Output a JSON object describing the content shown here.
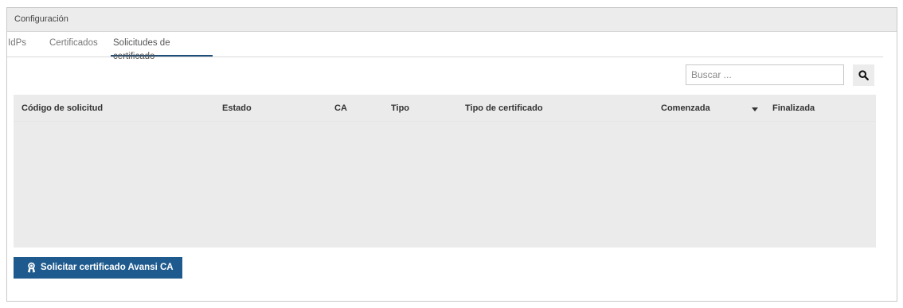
{
  "panel": {
    "title": "Configuración"
  },
  "tabs": [
    {
      "label": "IdPs",
      "active": false
    },
    {
      "label": "Certificados",
      "active": false
    },
    {
      "label": "Solicitudes de certificado",
      "active": true
    }
  ],
  "search": {
    "placeholder": "Buscar ...",
    "value": "",
    "icon": "search-icon"
  },
  "table": {
    "columns": [
      {
        "label": "Código de solicitud"
      },
      {
        "label": "Estado"
      },
      {
        "label": "CA"
      },
      {
        "label": "Tipo"
      },
      {
        "label": "Tipo de certificado"
      },
      {
        "label": "Comenzada",
        "sorted": "descending"
      },
      {
        "label": "Finalizada"
      }
    ],
    "rows": []
  },
  "actions": {
    "request_button_label": "Solicitar certificado Avansi CA",
    "request_button_icon": "certificate-icon",
    "accent_color": "#1e5a8e"
  }
}
